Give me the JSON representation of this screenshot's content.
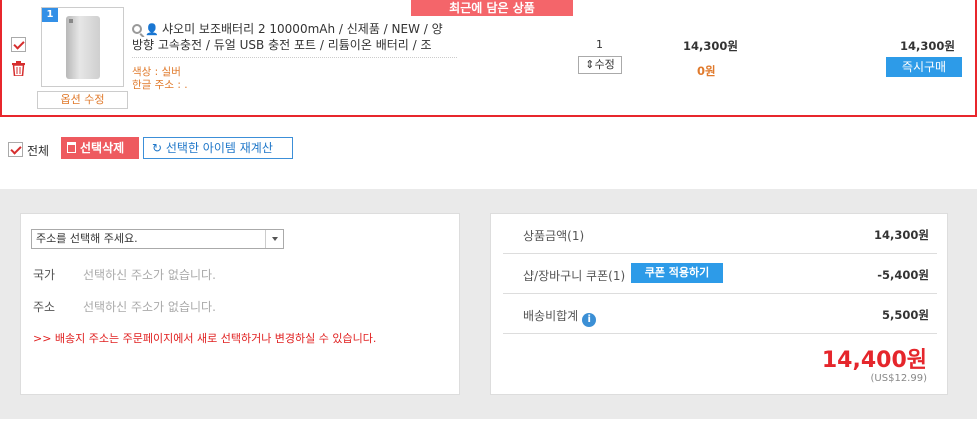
{
  "recent_tab": "최근에 담은 상품",
  "item": {
    "index": "1",
    "title_line1": "샤오미 보조배터리 2 10000mAh / 신제품 / NEW / 양",
    "title_line2": "방향 고속충전 / 듀얼 USB 충전 포트 / 리튬이온 배터리 / 조",
    "option_color": "색상 : 실버",
    "option_address": "한글 주소 : .",
    "option_edit_label": "옵션 수정",
    "quantity": "1",
    "qty_edit_label": "수정",
    "price": "14,300원",
    "shipping": "0원",
    "subtotal": "14,300원",
    "buy_now_label": "즉시구매"
  },
  "actions": {
    "select_all_label": "전체",
    "delete_label": "선택삭제",
    "recalc_label": "선택한 아이템 재계산"
  },
  "address": {
    "select_placeholder": "주소를 선택해 주세요.",
    "country_label": "국가",
    "country_value": "선택하신 주소가 없습니다.",
    "address_label": "주소",
    "address_value": "선택하신 주소가 없습니다.",
    "note": ">> 배송지 주소는 주문페이지에서 새로 선택하거나 변경하실 수 있습니다."
  },
  "summary": {
    "product_label": "상품금액(1)",
    "product_value": "14,300원",
    "coupon_label": "샵/장바구니 쿠폰(1)",
    "coupon_button": "쿠폰 적용하기",
    "coupon_value": "-5,400원",
    "shipping_label": "배송비합계",
    "shipping_value": "5,500원",
    "total": "14,400원",
    "total_usd": "(US$12.99)"
  },
  "colors": {
    "accent_red": "#e5262c",
    "accent_blue": "#2d9be8",
    "orange": "#e07a2c"
  }
}
